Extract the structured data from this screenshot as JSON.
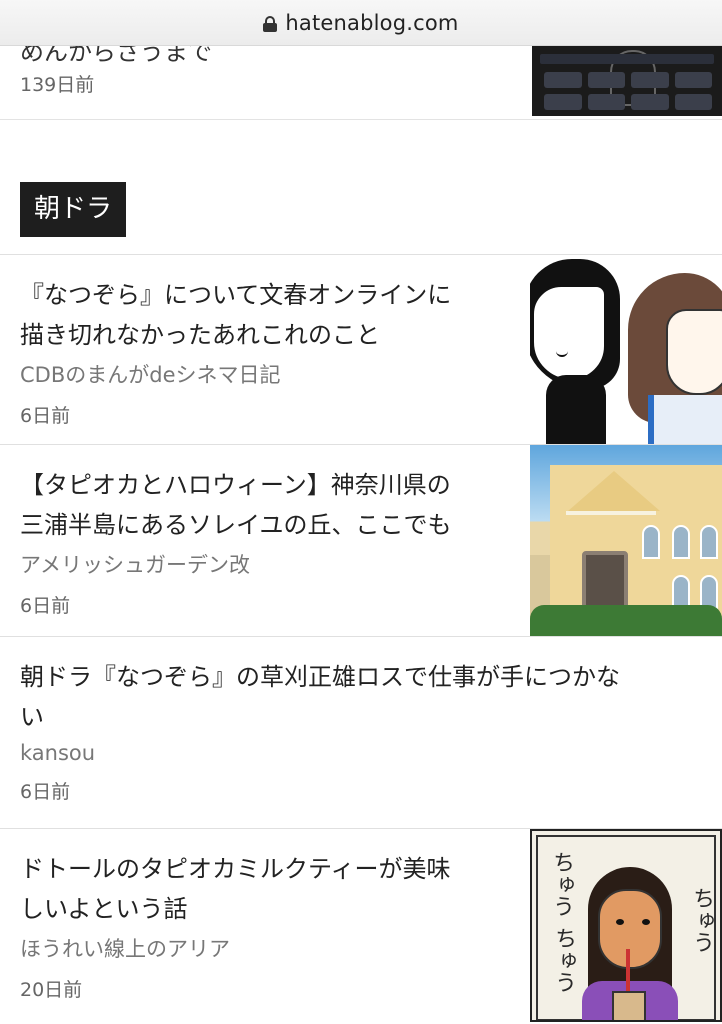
{
  "browser": {
    "url": "hatenablog.com"
  },
  "previous_item": {
    "title_fragment": "めんからさうまで",
    "date": "139日前"
  },
  "section": {
    "label": "朝ドラ"
  },
  "items": [
    {
      "title_lines": [
        "『なつぞら』について文春オンラインに",
        "描き切れなかったあれこれのこと"
      ],
      "blog": "CDBのまんがdeシネマ日記",
      "date": "6日前",
      "has_thumbnail": true
    },
    {
      "title_lines": [
        "【タピオカとハロウィーン】神奈川県の",
        "三浦半島にあるソレイユの丘、ここでも"
      ],
      "blog": "アメリッシュガーデン改",
      "date": "6日前",
      "has_thumbnail": true
    },
    {
      "title_lines": [
        "朝ドラ『なつぞら』の草刈正雄ロスで仕事が手につかな",
        "い"
      ],
      "blog": "kansou",
      "date": "6日前",
      "has_thumbnail": false
    },
    {
      "title_lines": [
        "ドトールのタピオカミルクティーが美味",
        "しいよという話"
      ],
      "blog": "ほうれい線上のアリア",
      "date": "20日前",
      "has_thumbnail": true,
      "thumbnail_text": [
        "ちゅう",
        "ちゅう",
        "ちゅう"
      ]
    }
  ]
}
